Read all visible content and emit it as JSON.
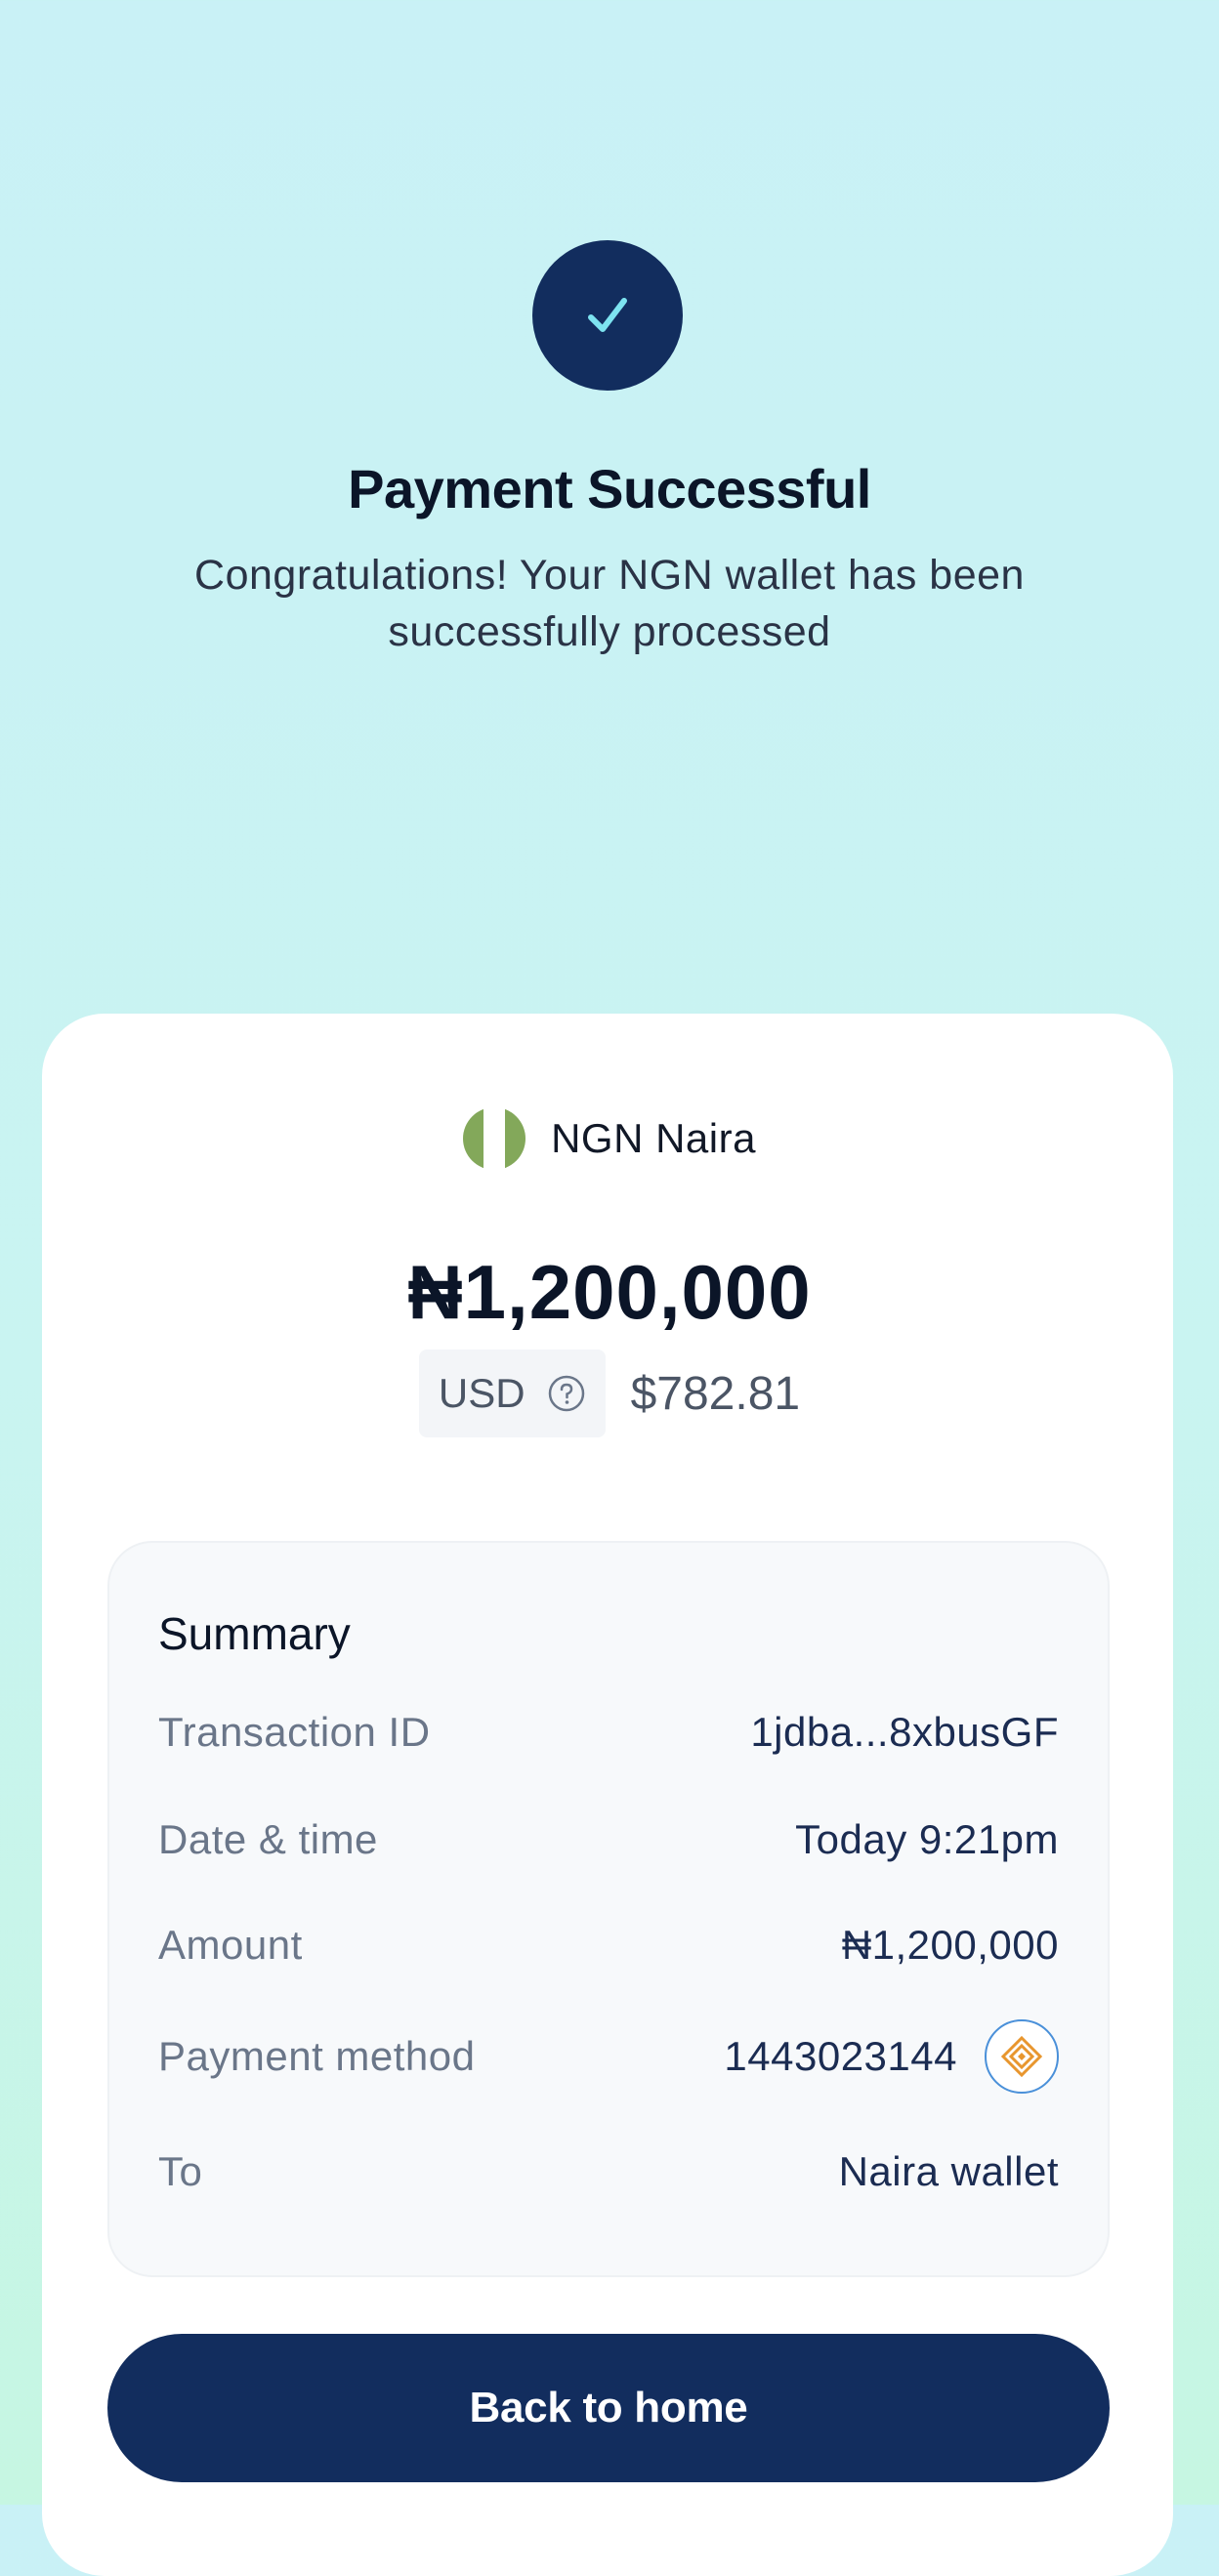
{
  "status": {
    "icon": "checkmark-icon",
    "title": "Payment Successful",
    "subtitle": "Congratulations! Your NGN wallet has been successfully processed"
  },
  "currency": {
    "flag_icon": "nigeria-flag-icon",
    "name": "NGN Naira"
  },
  "amount": {
    "main": "₦1,200,000",
    "usd_label": "USD",
    "usd_help_icon": "question-circle-icon",
    "usd_value": "$782.81"
  },
  "summary": {
    "title": "Summary",
    "rows": [
      {
        "label": "Transaction ID",
        "value": "1jdba...8xbusGF"
      },
      {
        "label": "Date & time",
        "value": "Today 9:21pm"
      },
      {
        "label": "Amount",
        "value": "₦1,200,000"
      },
      {
        "label": "Payment method",
        "value": "1443023144",
        "icon": "bank-logo-icon"
      },
      {
        "label": "To",
        "value": "Naira wallet"
      }
    ]
  },
  "actions": {
    "back_home_label": "Back to home"
  },
  "colors": {
    "primary": "#122d5e",
    "checkmark": "#7de3f0",
    "flag_green": "#83a85a",
    "bank_logo": "#e8962e"
  }
}
